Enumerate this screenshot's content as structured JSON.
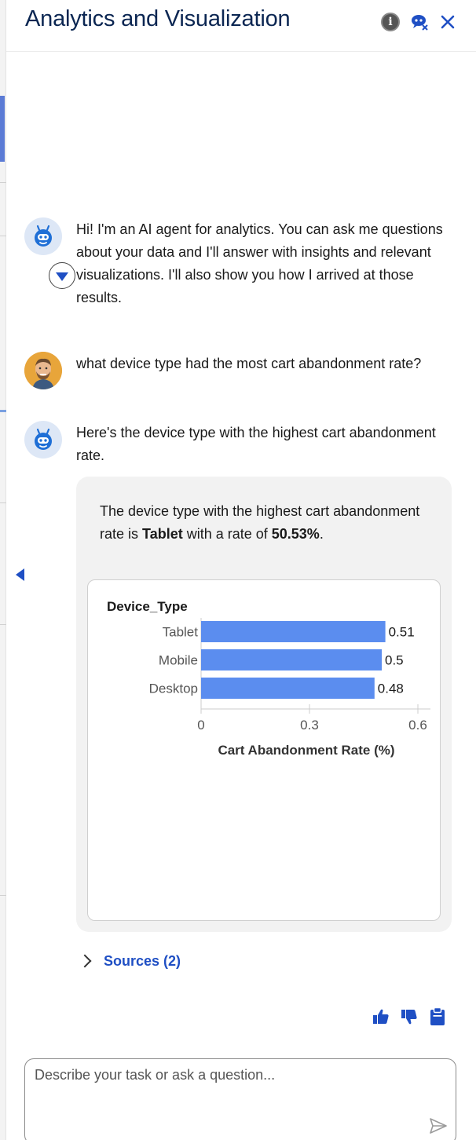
{
  "header": {
    "title": "Analytics and Visualization",
    "info_icon": "info-icon",
    "bot_icon": "bot-close-icon",
    "close_icon": "close-icon"
  },
  "messages": [
    {
      "role": "agent",
      "text": "Hi! I'm an AI agent for analytics. You can ask me questions about your data and I'll answer with insights and relevant visualizations. I'll also show you how I arrived at those results."
    },
    {
      "role": "user",
      "text": "what device type had the most cart abandonment rate?"
    },
    {
      "role": "agent",
      "text": "Here's the device type with the highest cart abandonment rate."
    }
  ],
  "response_card": {
    "text_before": "The device type with the highest cart abandonment rate is ",
    "highlight_device": "Tablet",
    "text_middle": " with a rate of ",
    "highlight_rate": "50.53%",
    "text_after": "."
  },
  "chart_data": {
    "type": "bar",
    "orientation": "horizontal",
    "category_title": "Device_Type",
    "categories": [
      "Tablet",
      "Mobile",
      "Desktop"
    ],
    "values": [
      0.51,
      0.5,
      0.48
    ],
    "value_labels": [
      "0.51",
      "0.5",
      "0.48"
    ],
    "xlabel": "Cart Abandonment Rate (%)",
    "xlim": [
      0,
      0.6
    ],
    "xticks": [
      0,
      0.3,
      0.6
    ],
    "xtick_labels": [
      "0",
      "0.3",
      "0.6"
    ],
    "bar_color": "#5b8def",
    "grid": false
  },
  "sources": {
    "label": "Sources (2)"
  },
  "feedback": {
    "icons": [
      "thumbs-up-icon",
      "thumbs-down-icon",
      "clipboard-icon"
    ]
  },
  "input": {
    "placeholder": "Describe your task or ask a question...",
    "value": ""
  },
  "colors": {
    "accent": "#1f4fc4",
    "title": "#0b2652",
    "card_bg": "#f2f2f2",
    "avatar_bg": "#dde7f6"
  }
}
